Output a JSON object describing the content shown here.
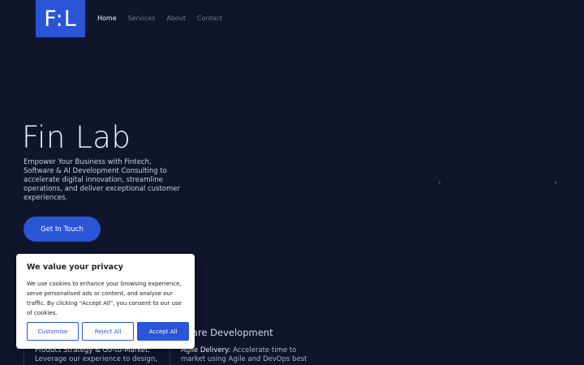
{
  "header": {
    "logo_text": "F:L",
    "nav": [
      {
        "label": "Home"
      },
      {
        "label": "Services"
      },
      {
        "label": "About"
      },
      {
        "label": "Contact"
      }
    ]
  },
  "hero": {
    "title": "Fin Lab",
    "description": "Empower Your Business with Fintech, Software & AI Development Consulting to accelerate digital innovation, streamline operations, and deliver exceptional customer experiences.",
    "cta_label": "Get In Touch"
  },
  "services": {
    "right_heading": "tware Development",
    "left_item_title": "Product Strategy & Go-to-Market:",
    "left_item_text": "Leverage our experience to design,",
    "right_item_title": "Agile Delivery:",
    "right_item_text": "Accelerate time to market using Agile and DevOps best"
  },
  "cookie_banner": {
    "title": "We value your privacy",
    "text": "We use cookies to enhance your browsing experience, serve personalised ads or content, and analyse our traffic. By clicking \"Accept All\", you consent to our use of cookies.",
    "customise_label": "Customise",
    "reject_label": "Reject All",
    "accept_label": "Accept All"
  },
  "colors": {
    "background": "#0f162c",
    "accent": "#2a55d6"
  }
}
